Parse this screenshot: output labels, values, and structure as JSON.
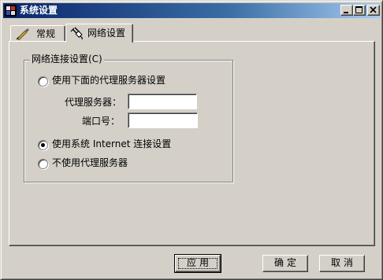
{
  "window": {
    "title": "系统设置"
  },
  "title_buttons": {
    "minimize": "minimize-icon",
    "maximize": "maximize-icon",
    "close": "close-icon"
  },
  "tabs": [
    {
      "label": "常规",
      "icon": "pen-icon",
      "active": false
    },
    {
      "label": "网络设置",
      "icon": "network-plug-icon",
      "active": true
    }
  ],
  "group": {
    "legend": "网络连接设置(C)",
    "options": [
      {
        "label": "使用下面的代理服务器设置",
        "selected": false
      },
      {
        "label": "使用系统 Internet 连接设置",
        "selected": true
      },
      {
        "label": "不使用代理服务器",
        "selected": false
      }
    ],
    "proxy_label": "代理服务器：",
    "proxy_value": "",
    "port_label": "端口号：",
    "port_value": ""
  },
  "buttons": {
    "apply": "应用",
    "ok": "确定",
    "cancel": "取消"
  },
  "colors": {
    "face": "#d4d0c8",
    "title_start": "#0a246a",
    "title_end": "#a6caf0"
  }
}
